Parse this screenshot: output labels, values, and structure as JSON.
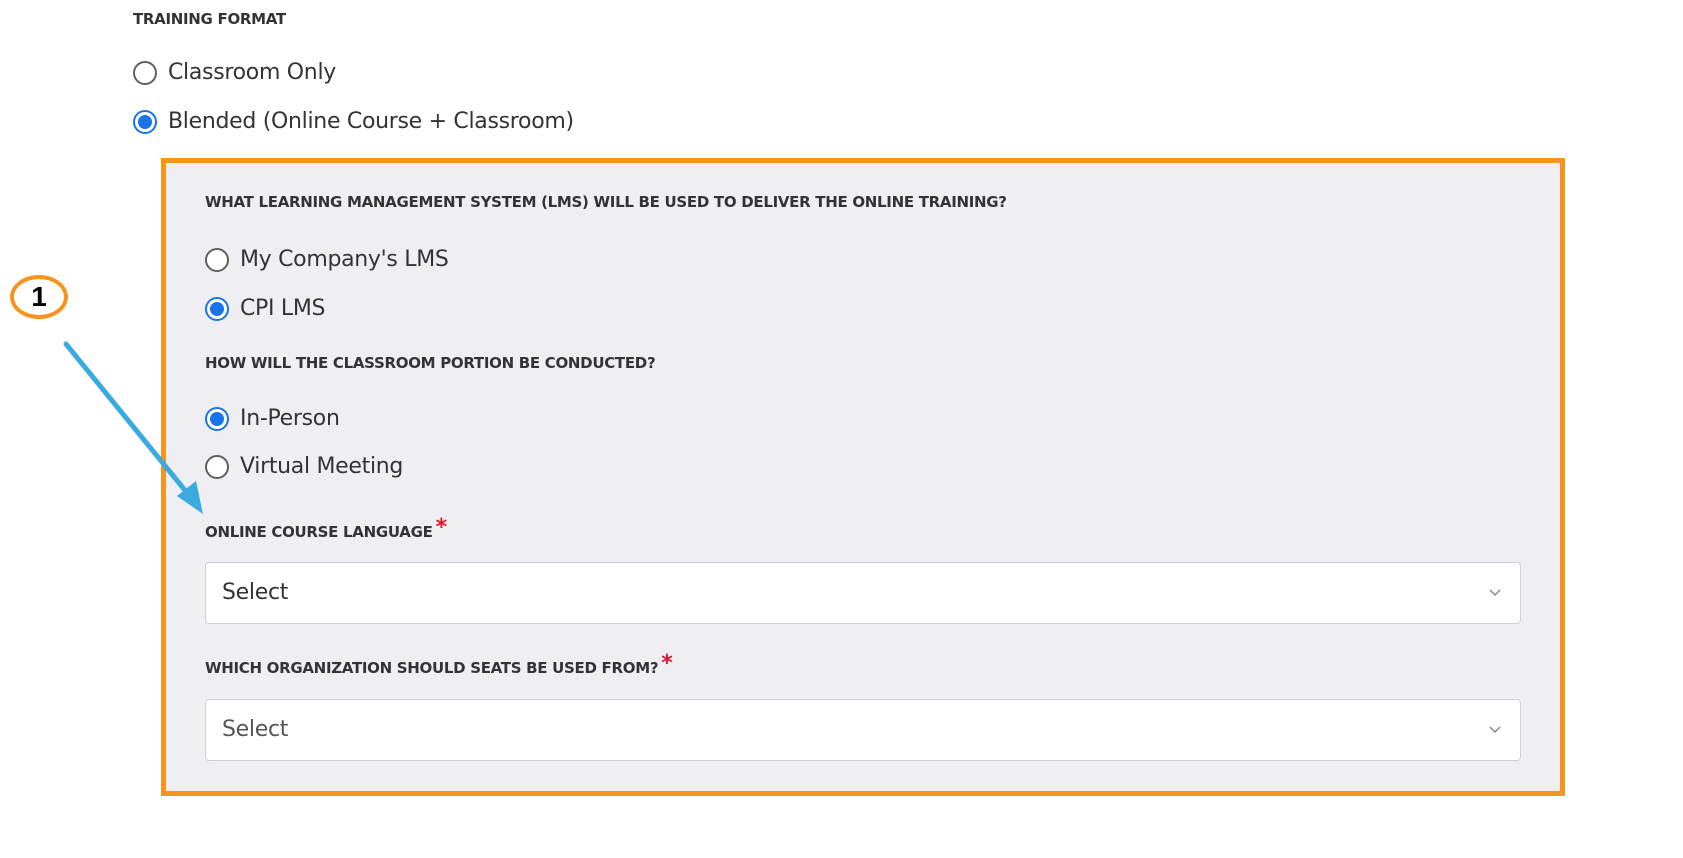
{
  "training_format": {
    "label": "TRAINING FORMAT",
    "options": [
      {
        "label": "Classroom Only",
        "checked": false
      },
      {
        "label": "Blended (Online Course + Classroom)",
        "checked": true
      }
    ]
  },
  "blended_panel": {
    "lms_question": {
      "label": "WHAT LEARNING MANAGEMENT SYSTEM (LMS) WILL BE USED TO DELIVER THE ONLINE TRAINING?",
      "options": [
        {
          "label": "My Company's LMS",
          "checked": false
        },
        {
          "label": "CPI LMS",
          "checked": true
        }
      ]
    },
    "classroom_question": {
      "label": "HOW WILL THE CLASSROOM PORTION BE CONDUCTED?",
      "options": [
        {
          "label": "In-Person",
          "checked": true
        },
        {
          "label": "Virtual Meeting",
          "checked": false
        }
      ]
    },
    "language_field": {
      "label": "ONLINE COURSE LANGUAGE",
      "required_mark": "*",
      "value": "Select"
    },
    "organization_field": {
      "label": "WHICH ORGANIZATION SHOULD SEATS BE USED FROM?",
      "required_mark": "*",
      "value": "Select"
    }
  },
  "annotation": {
    "callout_number": "1"
  },
  "colors": {
    "panel_border": "#f7941d",
    "panel_background": "#efeff3",
    "radio_selected": "#1a73e8",
    "required_star": "#e0112b",
    "callout_arrow": "#3aaadf"
  },
  "icons": {
    "select_chevron": "chevron-down-icon"
  }
}
